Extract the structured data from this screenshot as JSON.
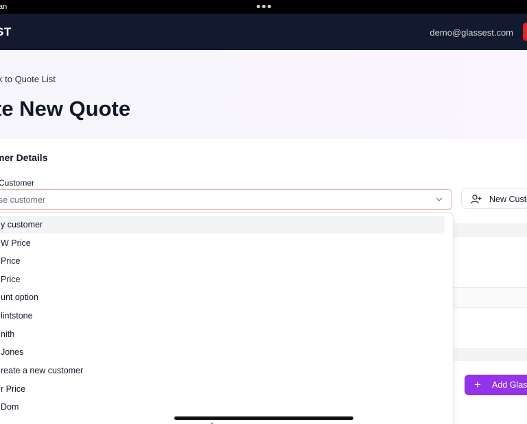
{
  "statusbar": {
    "carrier": "an"
  },
  "nav": {
    "brand": "ST",
    "user_email": "demo@glassest.com"
  },
  "hero": {
    "back_link": "k to Quote List",
    "title": "te New Quote"
  },
  "customer_section": {
    "title": "mer Details",
    "field_label": "Customer",
    "select_placeholder": "se customer",
    "new_customer_button": "New Custo"
  },
  "dropdown": {
    "options": [
      "y customer",
      "W Price",
      " Price",
      " Price",
      "unt option",
      "lintstone",
      "nith",
      "Jones",
      "reate a new customer",
      "r Price",
      "Dom"
    ],
    "scroll_down_glyph": "⌄"
  },
  "glass_section": {
    "add_button": "Add Glass"
  },
  "colors": {
    "nav_bg": "#111a2e",
    "accent": "#9333ea",
    "danger": "#dc2626"
  }
}
